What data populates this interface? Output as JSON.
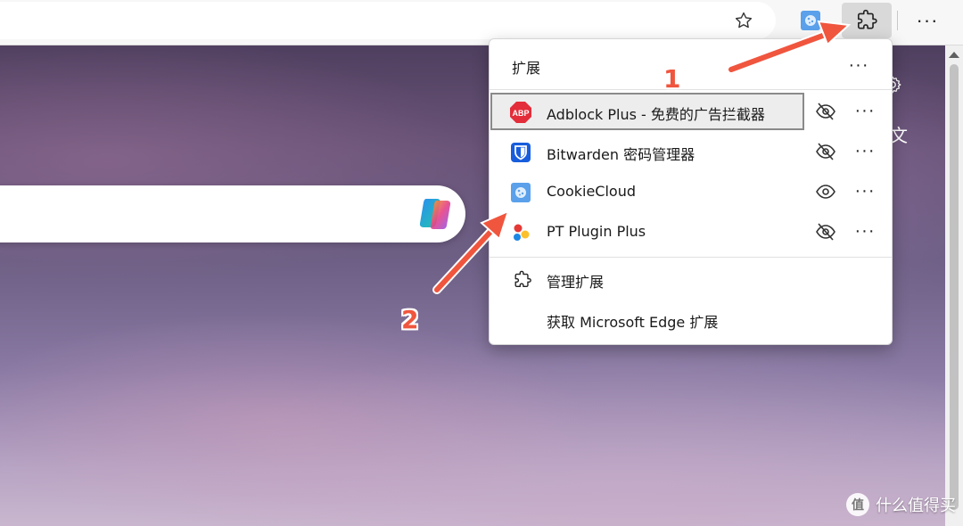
{
  "toolbar": {
    "star_icon": "star-outline-icon",
    "extensions_icon": "puzzle-icon",
    "more_label": "···"
  },
  "flyout": {
    "title": "扩展",
    "more_label": "···",
    "extensions": [
      {
        "name": "Adblock Plus - 免费的广告拦截器",
        "icon": "abp-icon",
        "visibility": "hidden",
        "highlighted": true
      },
      {
        "name": "Bitwarden 密码管理器",
        "icon": "bitwarden-icon",
        "visibility": "hidden",
        "highlighted": false
      },
      {
        "name": "CookieCloud",
        "icon": "cookiecloud-icon",
        "visibility": "shown",
        "highlighted": false
      },
      {
        "name": "PT Plugin Plus",
        "icon": "ptpp-icon",
        "visibility": "hidden",
        "highlighted": false
      }
    ],
    "row_more_label": "···",
    "manage_label": "管理扩展",
    "get_label": "获取 Microsoft Edge 扩展"
  },
  "page": {
    "side_text": "文"
  },
  "annotations": {
    "one": "1",
    "two": "2"
  },
  "watermark": {
    "text": "什么值得买"
  },
  "colors": {
    "arrow": "#f0553e",
    "abp_red": "#e32d3a",
    "bitwarden_blue": "#175ddc",
    "cookie_blue": "#4a90e2"
  }
}
